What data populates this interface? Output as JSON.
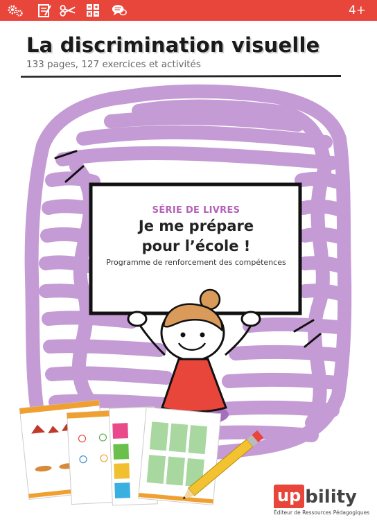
{
  "topbar": {
    "icons": [
      "gears-icon",
      "worksheet-icon",
      "scissors-icon",
      "math-operations-icon",
      "speech-bubbles-icon"
    ],
    "age": "4+",
    "color": "#e8453b"
  },
  "cover": {
    "title": "La discrimination visuelle",
    "subtitle": "133 pages, 127 exercices et activités"
  },
  "sign": {
    "series": "SÉRIE DE LIVRES",
    "title_line1": "Je me prépare",
    "title_line2": "pour l’école !",
    "program": "Programme de renforcement des compétences"
  },
  "publisher": {
    "logo_up": "up",
    "logo_bility": "bility",
    "tagline": "Éditeur de Ressources Pédagogiques"
  },
  "colors": {
    "accent": "#e8453b",
    "scribble": "#c49bd4",
    "series_text": "#b55fb8",
    "dress": "#e8453b"
  }
}
